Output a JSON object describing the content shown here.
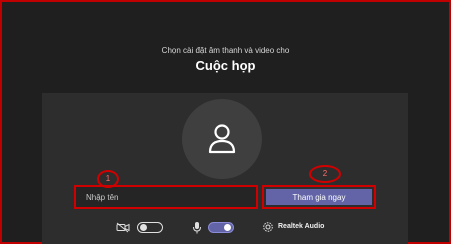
{
  "header": {
    "subtitle": "Chọn cài đặt âm thanh và video cho",
    "title": "Cuộc họp"
  },
  "join": {
    "name_placeholder": "Nhập tên",
    "join_label": "Tham gia ngay"
  },
  "annotations": {
    "step1": "1",
    "step2": "2"
  },
  "devices": {
    "audio_label": "Realtek Audio",
    "camera_on": false,
    "mic_on": true
  },
  "colors": {
    "background": "#1f1f1f",
    "panel": "#2d2d2d",
    "accent": "#6264a7",
    "highlight": "#d10000"
  },
  "icons": [
    "camera-off-icon",
    "microphone-icon",
    "gear-icon",
    "person-avatar-icon"
  ]
}
